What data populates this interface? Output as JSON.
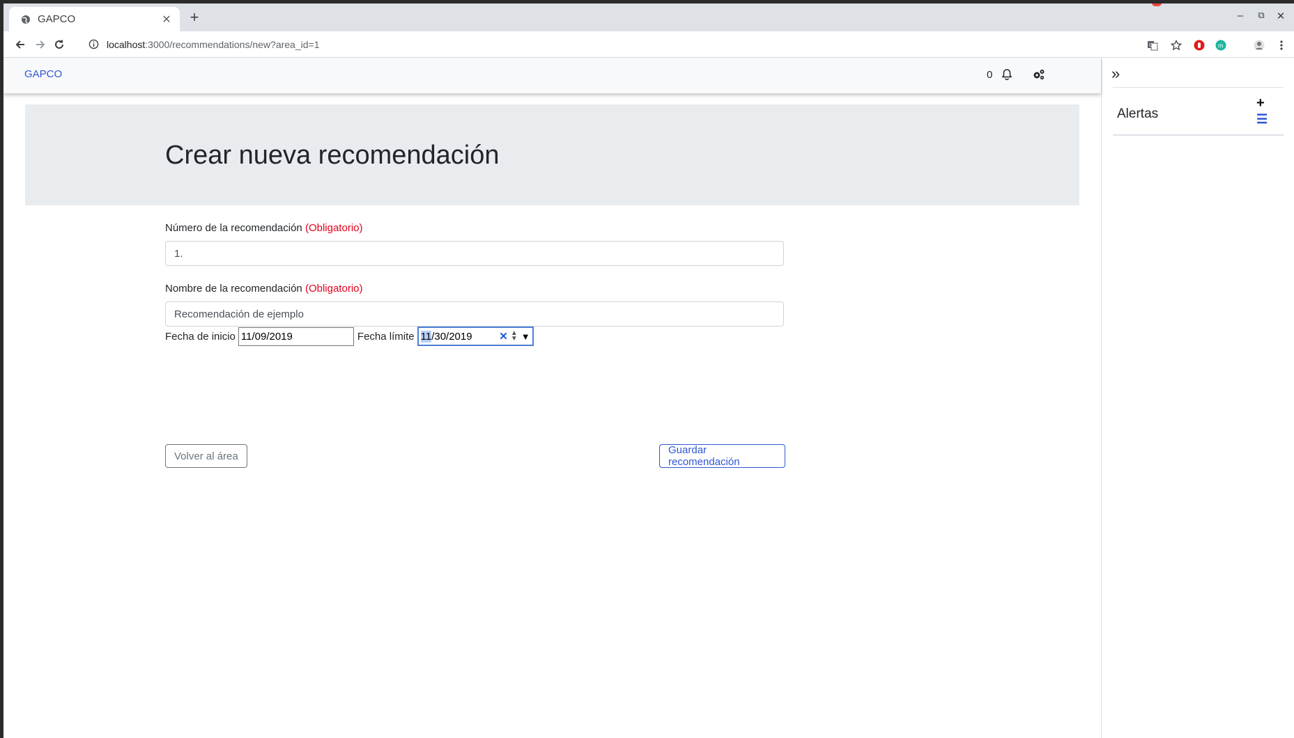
{
  "browser": {
    "tab_title": "GAPCO",
    "url_host": "localhost",
    "url_rest": ":3000/recommendations/new?area_id=1"
  },
  "navbar": {
    "brand": "GAPCO",
    "notification_count": "0"
  },
  "page": {
    "title": "Crear nueva recomendación"
  },
  "form": {
    "number_label": "Número de la recomendación",
    "number_required": "(Obligatorio)",
    "number_value": "1.",
    "name_label": "Nombre de la recomendación",
    "name_required": "(Obligatorio)",
    "name_value": "Recomendación de ejemplo",
    "start_label": "Fecha de inicio",
    "start_value": "11/09/2019",
    "end_label": "Fecha límite",
    "end_value_selected": "11",
    "end_value_rest": "/30/2019",
    "back_button": "Volver al área",
    "save_button": "Guardar recomendación"
  },
  "sidebar": {
    "title": "Alertas"
  },
  "icons": {
    "accent": "#3056d3",
    "required_color": "#e3001b"
  }
}
